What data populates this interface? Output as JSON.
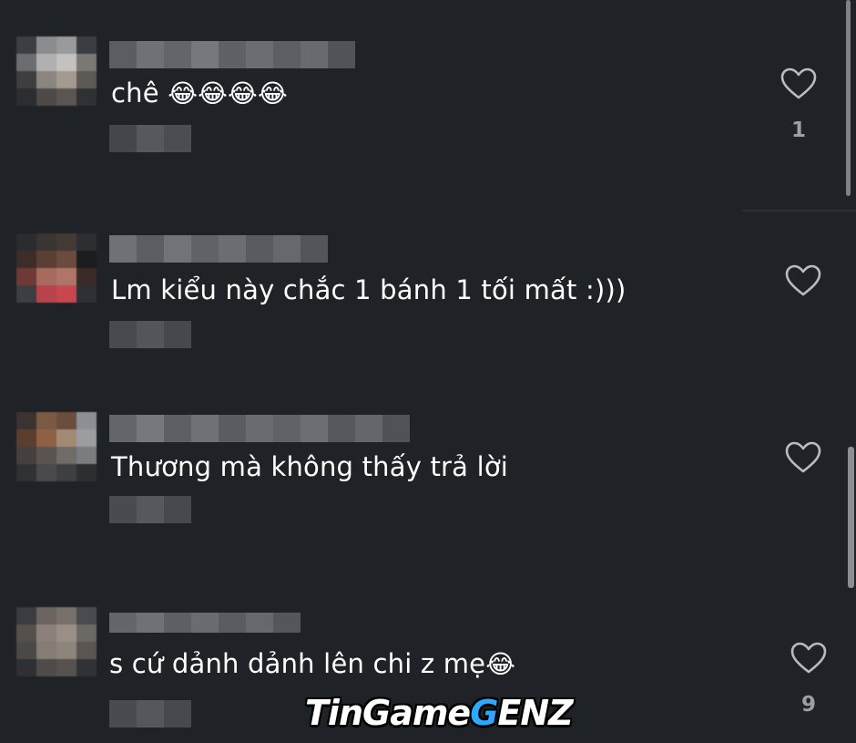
{
  "comments": [
    {
      "text": "chê",
      "emoji": "😂😂😂😂",
      "likes": "1"
    },
    {
      "text": "Lm kiểu này chắc 1 bánh 1 tối mất :)))",
      "emoji": "",
      "likes": ""
    },
    {
      "text": "Thương mà không thấy trả lời",
      "emoji": "",
      "likes": ""
    },
    {
      "text": "s cứ dảnh dảnh lên chi z mẹ",
      "emoji": "😂",
      "likes": "9"
    }
  ],
  "watermark": {
    "part1": "TinGame",
    "part2": "G",
    "part3": "ENZ"
  },
  "icons": {
    "like": "heart-outline-icon"
  },
  "colors": {
    "background": "#1f2226",
    "text": "#ffffff",
    "muted": "#9aa0a6",
    "watermark_accent": "#2ea7ff"
  }
}
